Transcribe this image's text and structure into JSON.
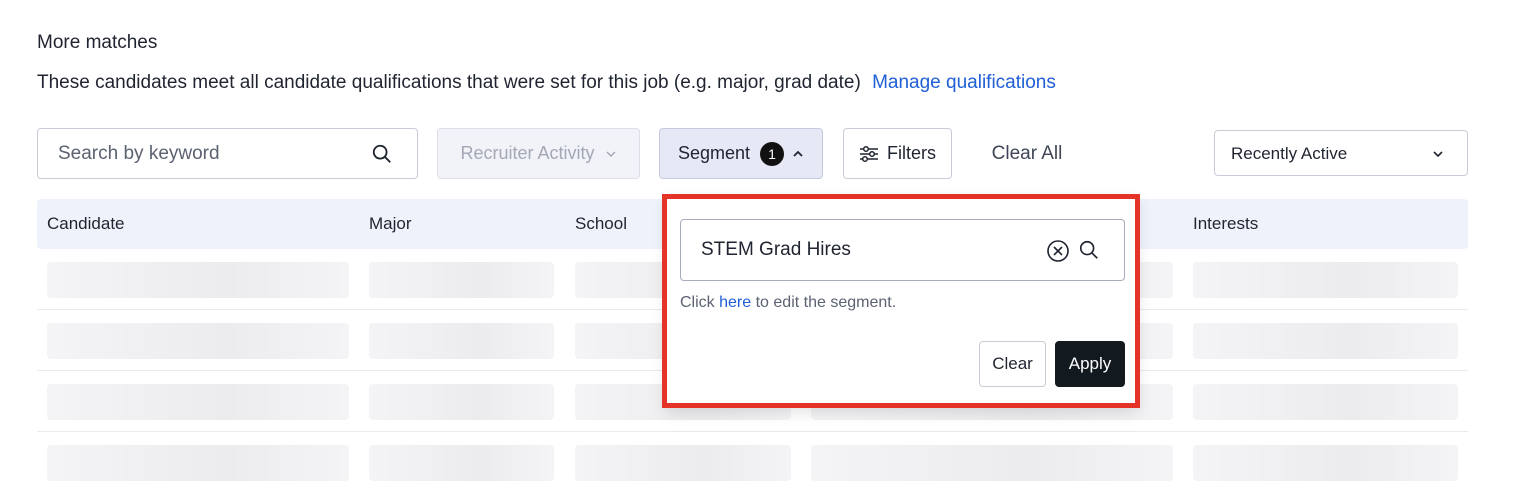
{
  "section": {
    "title": "More matches",
    "description": "These candidates meet all candidate qualifications that were set for this job (e.g. major, grad date)",
    "manage_link": "Manage qualifications"
  },
  "toolbar": {
    "search_placeholder": "Search by keyword",
    "recruiter_activity_label": "Recruiter Activity",
    "segment_label": "Segment",
    "segment_count": "1",
    "filters_label": "Filters",
    "clear_all_label": "Clear All",
    "sort_value": "Recently Active"
  },
  "table": {
    "columns": [
      "Candidate",
      "Major",
      "School",
      "Interests"
    ]
  },
  "segment_popover": {
    "input_value": "STEM Grad Hires",
    "hint_prefix": "Click",
    "hint_link": "here",
    "hint_suffix": "to edit the segment.",
    "clear_label": "Clear",
    "apply_label": "Apply"
  },
  "colors": {
    "accent_link": "#1f5fd6",
    "highlight": "#e63327",
    "apply_bg": "#121a1f"
  }
}
